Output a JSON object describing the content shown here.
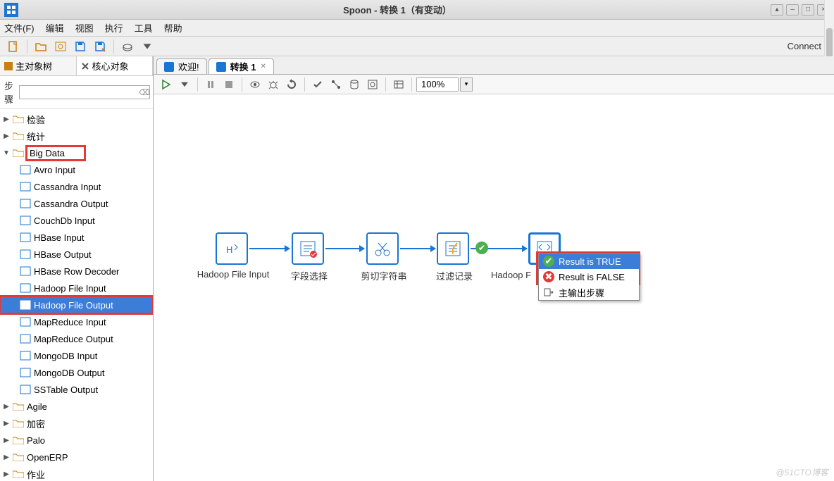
{
  "window": {
    "title": "Spoon - 转换 1（有变动）"
  },
  "winbtns": {
    "up": "▴",
    "min": "–",
    "max": "□",
    "close": "×"
  },
  "menu": {
    "file": "文件(F)",
    "edit": "编辑",
    "view": "视图",
    "run": "执行",
    "tools": "工具",
    "help": "帮助"
  },
  "toolbar": {
    "connect": "Connect"
  },
  "left_tabs": {
    "main": "主对象树",
    "core": "核心对象"
  },
  "search": {
    "label": "步骤",
    "value": "",
    "placeholder": ""
  },
  "tree": {
    "truncated_top": "检验",
    "folders_top": [
      "统计"
    ],
    "bigdata_label": "Big Data",
    "bigdata_items": [
      "Avro Input",
      "Cassandra Input",
      "Cassandra Output",
      "CouchDb Input",
      "HBase Input",
      "HBase Output",
      "HBase Row Decoder",
      "Hadoop File Input",
      "Hadoop File Output",
      "MapReduce Input",
      "MapReduce Output",
      "MongoDB Input",
      "MongoDB Output",
      "SSTable Output"
    ],
    "folders_bottom": [
      "Agile",
      "加密",
      "Palo",
      "OpenERP",
      "作业"
    ]
  },
  "editor_tabs": {
    "welcome": "欢迎!",
    "trans": "转换 1"
  },
  "canvas_toolbar": {
    "zoom": "100%"
  },
  "nodes": {
    "n1": "Hadoop File Input",
    "n2": "字段选择",
    "n3": "剪切字符串",
    "n4": "过滤记录",
    "n5": "Hadoop F"
  },
  "ctxmenu": {
    "true": "Result is TRUE",
    "false": "Result is FALSE",
    "main": "主输出步骤"
  },
  "watermark": "@51CTO博客"
}
